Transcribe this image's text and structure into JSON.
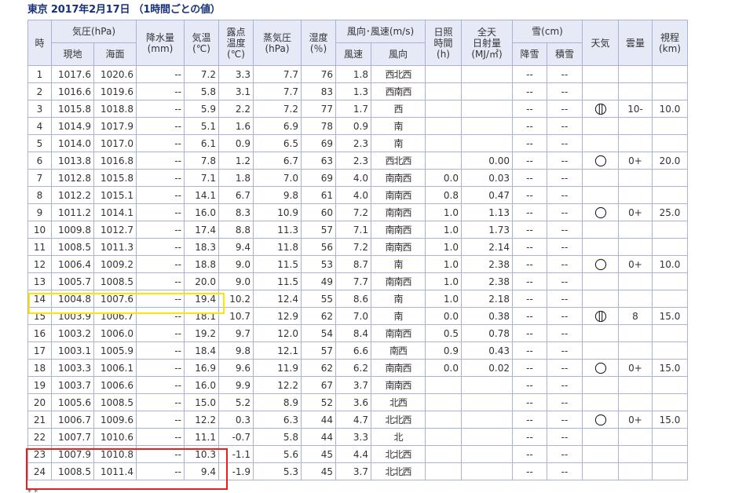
{
  "title": "東京 2017年2月17日 （1時間ごとの値）",
  "headers": {
    "hour": "時",
    "pressure": "気圧(hPa)",
    "pressure_station": "現地",
    "pressure_sea": "海面",
    "precip": "降水量\n(mm)",
    "temp": "気温\n(℃)",
    "dew": "露点\n温度\n(℃)",
    "vapor": "蒸気圧\n(hPa)",
    "humidity": "湿度\n(％)",
    "wind": "風向･風速(m/s)",
    "wind_speed": "風速",
    "wind_dir": "風向",
    "sunshine": "日照\n時間\n(h)",
    "radiation": "全天\n日射量\n(MJ/㎡)",
    "snow": "雪(cm)",
    "snowfall": "降雪",
    "snow_depth": "積雪",
    "weather": "天気",
    "cloud": "雲量",
    "visibility": "視程\n(km)"
  },
  "rows": [
    {
      "h": "1",
      "p": "1017.6",
      "sp": "1020.6",
      "pr": "--",
      "t": "7.2",
      "d": "3.3",
      "v": "7.7",
      "rh": "76",
      "ws": "1.8",
      "wd": "西北西",
      "sun": "",
      "rad": "",
      "sf": "--",
      "sd": "--",
      "w": "",
      "c": "",
      "vis": ""
    },
    {
      "h": "2",
      "p": "1016.6",
      "sp": "1019.6",
      "pr": "--",
      "t": "5.8",
      "d": "3.1",
      "v": "7.7",
      "rh": "83",
      "ws": "1.3",
      "wd": "西南西",
      "sun": "",
      "rad": "",
      "sf": "--",
      "sd": "--",
      "w": "",
      "c": "",
      "vis": ""
    },
    {
      "h": "3",
      "p": "1015.8",
      "sp": "1018.8",
      "pr": "--",
      "t": "5.9",
      "d": "2.2",
      "v": "7.2",
      "rh": "77",
      "ws": "1.7",
      "wd": "西",
      "sun": "",
      "rad": "",
      "sf": "--",
      "sd": "--",
      "w": "cloudy",
      "c": "10-",
      "vis": "10.0"
    },
    {
      "h": "4",
      "p": "1014.9",
      "sp": "1017.9",
      "pr": "--",
      "t": "5.1",
      "d": "1.6",
      "v": "6.9",
      "rh": "78",
      "ws": "0.9",
      "wd": "南",
      "sun": "",
      "rad": "",
      "sf": "--",
      "sd": "--",
      "w": "",
      "c": "",
      "vis": ""
    },
    {
      "h": "5",
      "p": "1014.0",
      "sp": "1017.0",
      "pr": "--",
      "t": "6.1",
      "d": "0.9",
      "v": "6.5",
      "rh": "69",
      "ws": "2.3",
      "wd": "南",
      "sun": "",
      "rad": "",
      "sf": "--",
      "sd": "--",
      "w": "",
      "c": "",
      "vis": ""
    },
    {
      "h": "6",
      "p": "1013.8",
      "sp": "1016.8",
      "pr": "--",
      "t": "7.8",
      "d": "1.2",
      "v": "6.7",
      "rh": "63",
      "ws": "2.3",
      "wd": "西北西",
      "sun": "",
      "rad": "0.00",
      "sf": "--",
      "sd": "--",
      "w": "clear",
      "c": "0+",
      "vis": "20.0"
    },
    {
      "h": "7",
      "p": "1012.8",
      "sp": "1015.8",
      "pr": "--",
      "t": "7.1",
      "d": "1.8",
      "v": "7.0",
      "rh": "69",
      "ws": "4.0",
      "wd": "南南西",
      "sun": "0.0",
      "rad": "0.03",
      "sf": "--",
      "sd": "--",
      "w": "",
      "c": "",
      "vis": ""
    },
    {
      "h": "8",
      "p": "1012.2",
      "sp": "1015.1",
      "pr": "--",
      "t": "14.1",
      "d": "6.7",
      "v": "9.8",
      "rh": "61",
      "ws": "4.0",
      "wd": "南南西",
      "sun": "0.8",
      "rad": "0.47",
      "sf": "--",
      "sd": "--",
      "w": "",
      "c": "",
      "vis": ""
    },
    {
      "h": "9",
      "p": "1011.2",
      "sp": "1014.1",
      "pr": "--",
      "t": "16.0",
      "d": "8.3",
      "v": "10.9",
      "rh": "60",
      "ws": "7.2",
      "wd": "南南西",
      "sun": "1.0",
      "rad": "1.13",
      "sf": "--",
      "sd": "--",
      "w": "clear",
      "c": "0+",
      "vis": "25.0"
    },
    {
      "h": "10",
      "p": "1009.8",
      "sp": "1012.7",
      "pr": "--",
      "t": "17.4",
      "d": "8.8",
      "v": "11.3",
      "rh": "57",
      "ws": "7.1",
      "wd": "南南西",
      "sun": "1.0",
      "rad": "1.73",
      "sf": "--",
      "sd": "--",
      "w": "",
      "c": "",
      "vis": ""
    },
    {
      "h": "11",
      "p": "1008.5",
      "sp": "1011.3",
      "pr": "--",
      "t": "18.3",
      "d": "9.4",
      "v": "11.8",
      "rh": "56",
      "ws": "7.2",
      "wd": "南南西",
      "sun": "1.0",
      "rad": "2.14",
      "sf": "--",
      "sd": "--",
      "w": "",
      "c": "",
      "vis": ""
    },
    {
      "h": "12",
      "p": "1006.4",
      "sp": "1009.2",
      "pr": "--",
      "t": "18.8",
      "d": "9.0",
      "v": "11.5",
      "rh": "53",
      "ws": "8.7",
      "wd": "南",
      "sun": "1.0",
      "rad": "2.38",
      "sf": "--",
      "sd": "--",
      "w": "clear",
      "c": "0+",
      "vis": "10.0"
    },
    {
      "h": "13",
      "p": "1005.7",
      "sp": "1008.5",
      "pr": "--",
      "t": "20.0",
      "d": "9.0",
      "v": "11.5",
      "rh": "49",
      "ws": "7.7",
      "wd": "南南西",
      "sun": "1.0",
      "rad": "2.38",
      "sf": "--",
      "sd": "--",
      "w": "",
      "c": "",
      "vis": ""
    },
    {
      "h": "14",
      "p": "1004.8",
      "sp": "1007.6",
      "pr": "--",
      "t": "19.4",
      "d": "10.2",
      "v": "12.4",
      "rh": "55",
      "ws": "8.6",
      "wd": "南",
      "sun": "1.0",
      "rad": "2.18",
      "sf": "--",
      "sd": "--",
      "w": "",
      "c": "",
      "vis": ""
    },
    {
      "h": "15",
      "p": "1003.9",
      "sp": "1006.7",
      "pr": "--",
      "t": "18.1",
      "d": "10.7",
      "v": "12.9",
      "rh": "62",
      "ws": "7.0",
      "wd": "南",
      "sun": "0.0",
      "rad": "0.38",
      "sf": "--",
      "sd": "--",
      "w": "cloudy",
      "c": "8",
      "vis": "15.0"
    },
    {
      "h": "16",
      "p": "1003.2",
      "sp": "1006.0",
      "pr": "--",
      "t": "19.2",
      "d": "9.7",
      "v": "12.0",
      "rh": "54",
      "ws": "8.4",
      "wd": "南南西",
      "sun": "0.5",
      "rad": "0.78",
      "sf": "--",
      "sd": "--",
      "w": "",
      "c": "",
      "vis": ""
    },
    {
      "h": "17",
      "p": "1003.1",
      "sp": "1005.9",
      "pr": "--",
      "t": "18.4",
      "d": "9.8",
      "v": "12.1",
      "rh": "57",
      "ws": "6.6",
      "wd": "南西",
      "sun": "0.9",
      "rad": "0.43",
      "sf": "--",
      "sd": "--",
      "w": "",
      "c": "",
      "vis": ""
    },
    {
      "h": "18",
      "p": "1003.3",
      "sp": "1006.1",
      "pr": "--",
      "t": "16.9",
      "d": "9.6",
      "v": "11.9",
      "rh": "62",
      "ws": "6.2",
      "wd": "南南西",
      "sun": "0.0",
      "rad": "0.02",
      "sf": "--",
      "sd": "--",
      "w": "clear",
      "c": "0+",
      "vis": "15.0"
    },
    {
      "h": "19",
      "p": "1003.7",
      "sp": "1006.6",
      "pr": "--",
      "t": "16.0",
      "d": "9.9",
      "v": "12.2",
      "rh": "67",
      "ws": "3.7",
      "wd": "南南西",
      "sun": "",
      "rad": "",
      "sf": "--",
      "sd": "--",
      "w": "",
      "c": "",
      "vis": ""
    },
    {
      "h": "20",
      "p": "1005.6",
      "sp": "1008.5",
      "pr": "--",
      "t": "15.0",
      "d": "5.2",
      "v": "8.9",
      "rh": "52",
      "ws": "3.6",
      "wd": "北西",
      "sun": "",
      "rad": "",
      "sf": "--",
      "sd": "--",
      "w": "",
      "c": "",
      "vis": ""
    },
    {
      "h": "21",
      "p": "1006.7",
      "sp": "1009.6",
      "pr": "--",
      "t": "12.2",
      "d": "0.3",
      "v": "6.3",
      "rh": "44",
      "ws": "4.7",
      "wd": "北北西",
      "sun": "",
      "rad": "",
      "sf": "--",
      "sd": "--",
      "w": "clear",
      "c": "0+",
      "vis": "15.0"
    },
    {
      "h": "22",
      "p": "1007.7",
      "sp": "1010.6",
      "pr": "--",
      "t": "11.1",
      "d": "-0.7",
      "v": "5.8",
      "rh": "44",
      "ws": "3.3",
      "wd": "北",
      "sun": "",
      "rad": "",
      "sf": "--",
      "sd": "--",
      "w": "",
      "c": "",
      "vis": ""
    },
    {
      "h": "23",
      "p": "1007.9",
      "sp": "1010.8",
      "pr": "--",
      "t": "10.3",
      "d": "-1.1",
      "v": "5.6",
      "rh": "45",
      "ws": "4.4",
      "wd": "北北西",
      "sun": "",
      "rad": "",
      "sf": "--",
      "sd": "--",
      "w": "",
      "c": "",
      "vis": ""
    },
    {
      "h": "24",
      "p": "1008.5",
      "sp": "1011.4",
      "pr": "--",
      "t": "9.4",
      "d": "-1.9",
      "v": "5.3",
      "rh": "45",
      "ws": "3.7",
      "wd": "北北西",
      "sun": "",
      "rad": "",
      "sf": "--",
      "sd": "--",
      "w": "",
      "c": "",
      "vis": ""
    }
  ],
  "highlight_yellow_rows": [
    "14"
  ],
  "highlight_red_rows": [
    "23",
    "24"
  ],
  "colors": {
    "title": "#17317a",
    "header_bg": "#e6eaf7",
    "border": "#a8b2d4",
    "yellow": "#ffe400",
    "red": "#e82020"
  }
}
